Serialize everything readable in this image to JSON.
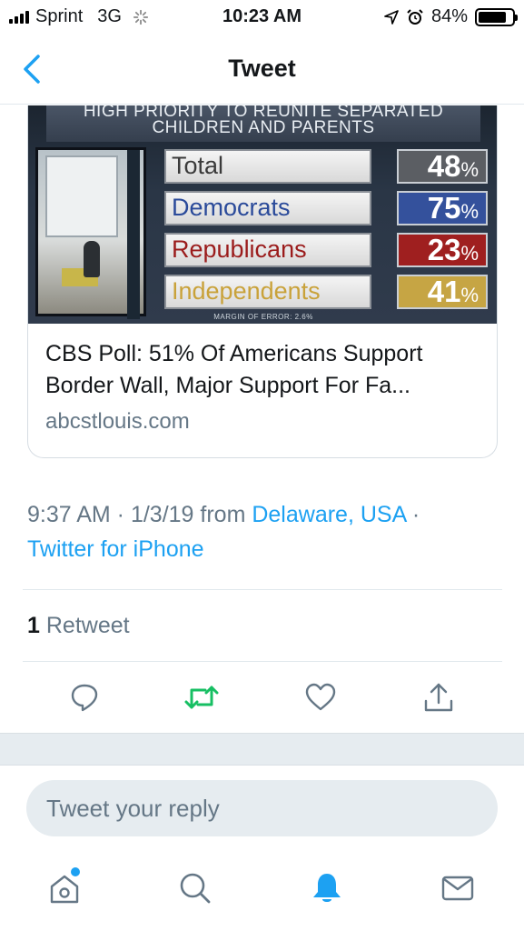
{
  "status_bar": {
    "carrier": "Sprint",
    "network": "3G",
    "time": "10:23 AM",
    "battery": "84%",
    "battery_level": 0.84
  },
  "nav": {
    "title": "Tweet",
    "back_icon": "chevron-left-icon"
  },
  "card": {
    "image": {
      "headline_line1": "HIGH PRIORITY TO REUNITE SEPARATED",
      "headline_line2": "CHILDREN AND PARENTS",
      "rows": [
        {
          "label": "Total",
          "value": "48",
          "pct": "%",
          "label_color": "#3a3a3a",
          "value_bg": "#5b5e63"
        },
        {
          "label": "Democrats",
          "value": "75",
          "pct": "%",
          "label_color": "#2a4a9a",
          "value_bg": "#34519c"
        },
        {
          "label": "Republicans",
          "value": "23",
          "pct": "%",
          "label_color": "#9b1c1c",
          "value_bg": "#9f1f1f"
        },
        {
          "label": "Independents",
          "value": "41",
          "pct": "%",
          "label_color": "#c9a23a",
          "value_bg": "#c6a544"
        }
      ],
      "margin_of_error": "MARGIN OF ERROR: 2.6%"
    },
    "title": "CBS Poll: 51% Of Americans Support Border Wall, Major Support For Fa...",
    "domain": "abcstlouis.com"
  },
  "meta": {
    "time_date": "9:37 AM · 1/3/19 from ",
    "location": "Delaware, USA",
    "separator": " ·",
    "source": "Twitter for iPhone"
  },
  "stats": {
    "retweet_count": "1",
    "retweet_label": "Retweet"
  },
  "actions": {
    "reply_icon": "reply-icon",
    "retweet_icon": "retweet-icon",
    "like_icon": "heart-icon",
    "share_icon": "share-icon",
    "retweet_color": "#17bf63"
  },
  "reply": {
    "placeholder": "Tweet your reply"
  },
  "tabs": [
    "home-icon",
    "search-icon",
    "notifications-icon",
    "messages-icon"
  ],
  "colors": {
    "accent": "#1da1f2",
    "text_secondary": "#657786"
  }
}
